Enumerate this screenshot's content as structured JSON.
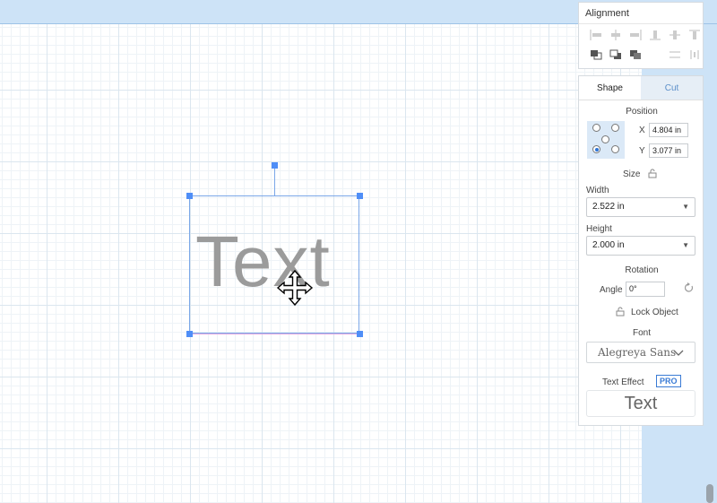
{
  "canvas": {
    "text_object": "Text"
  },
  "alignment_panel": {
    "title": "Alignment"
  },
  "shape_panel": {
    "tabs": [
      "Shape",
      "Cut"
    ],
    "position_label": "Position",
    "x_label": "X",
    "x_value": "4.804 in",
    "y_label": "Y",
    "y_value": "3.077 in",
    "size_label": "Size",
    "width_label": "Width",
    "width_value": "2.522 in",
    "height_label": "Height",
    "height_value": "2.000 in",
    "rotation_label": "Rotation",
    "angle_label": "Angle",
    "angle_value": "0°",
    "lock_object_label": "Lock Object",
    "font_label": "Font",
    "font_value": "Alegreya Sans",
    "text_effect_label": "Text Effect",
    "pro_badge": "PRO",
    "text_effect_preview": "Text"
  },
  "colors": {
    "accent": "#4f8ef7",
    "panel_tab_inactive": "#e6eef6"
  }
}
